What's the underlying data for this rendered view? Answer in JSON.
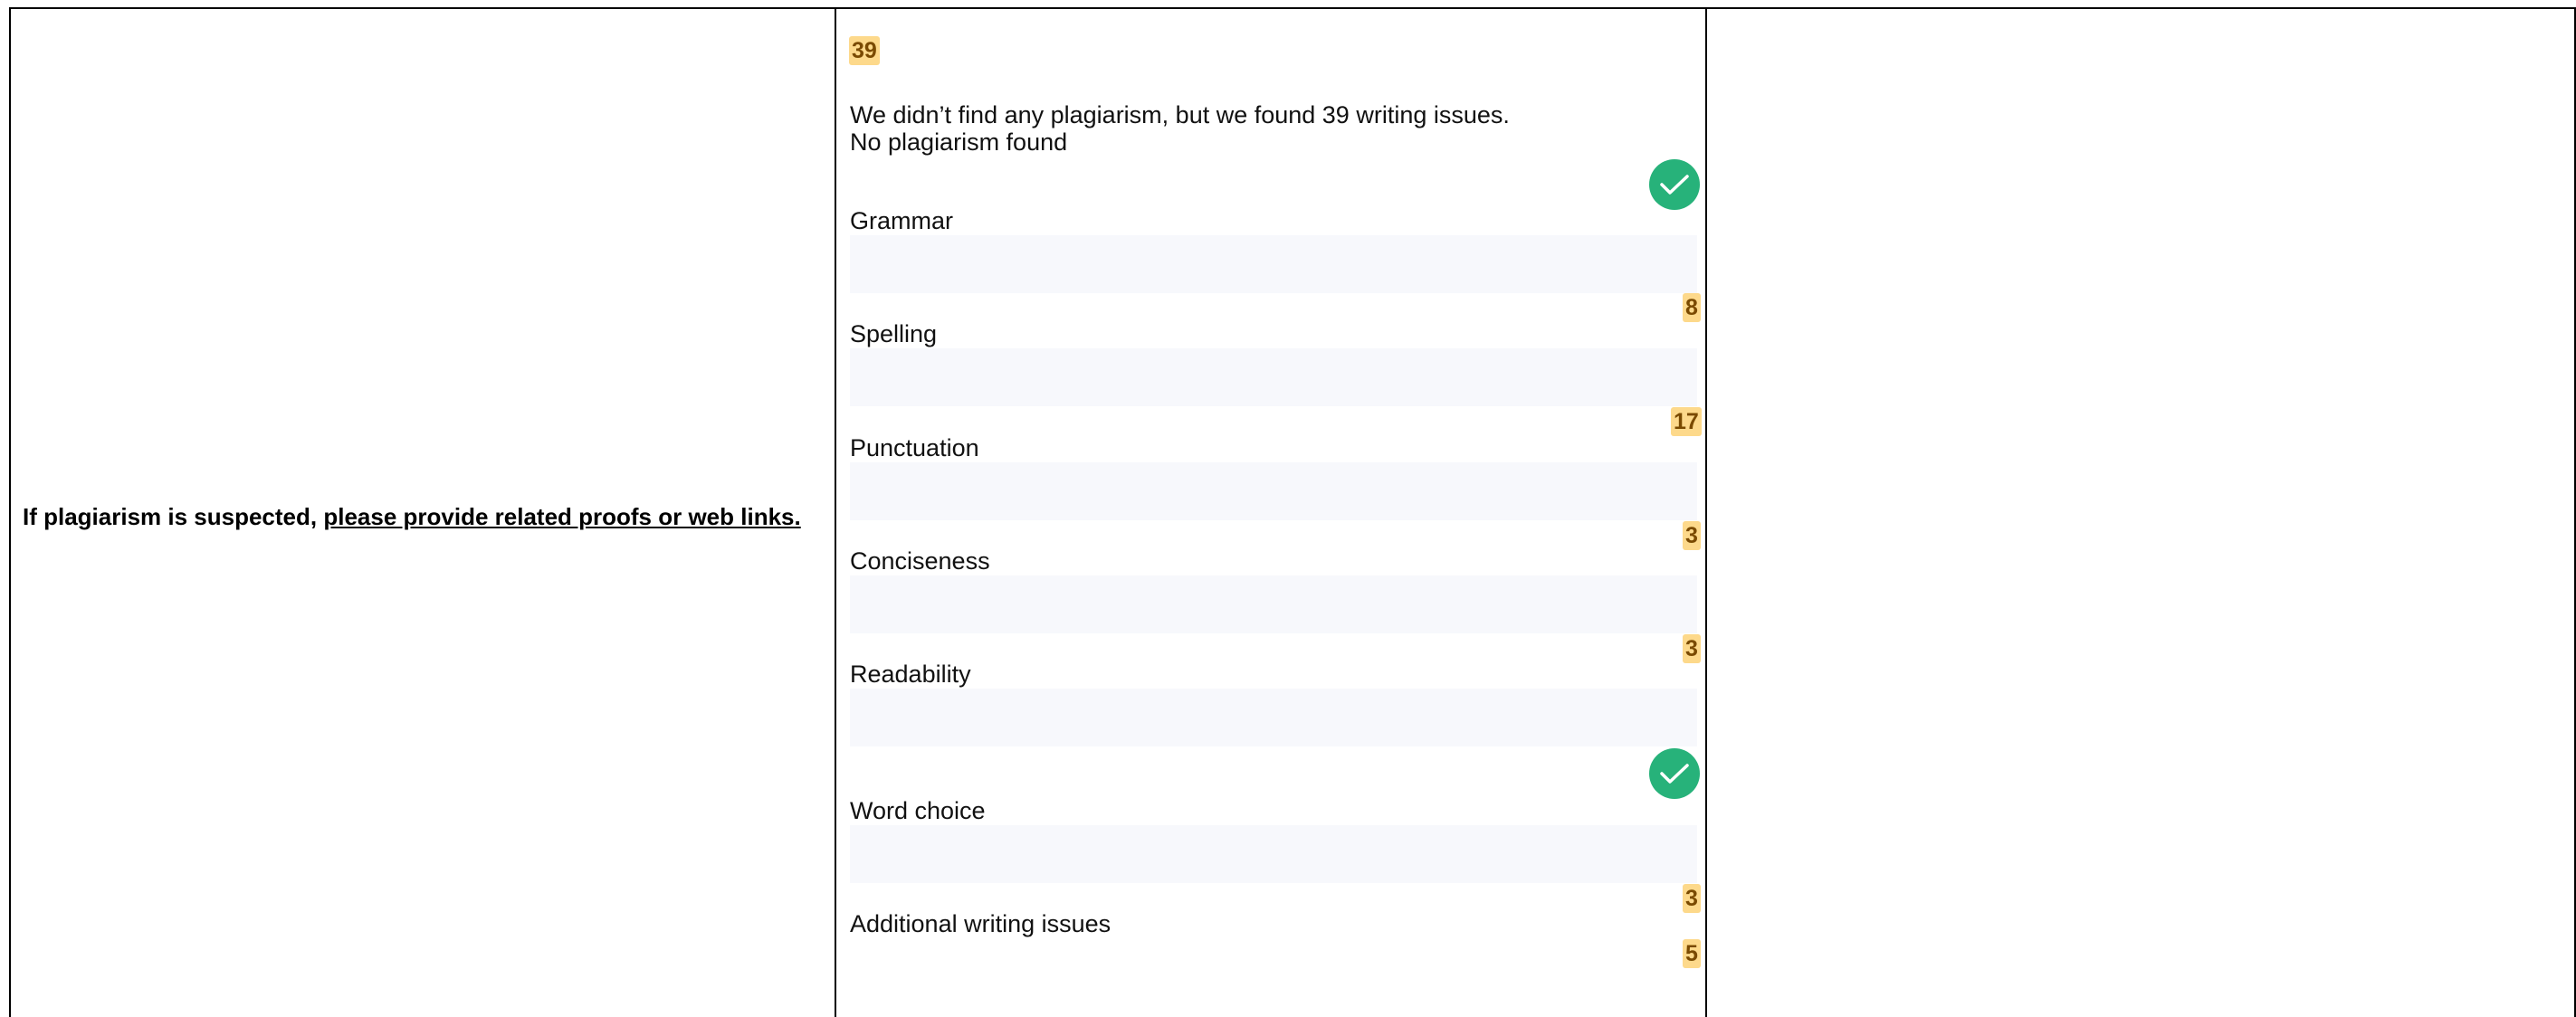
{
  "left": {
    "suspect_text": "If plagiarism is suspected, ",
    "suspect_link": "please provide related proofs or web links."
  },
  "report": {
    "total_issues": "39",
    "summary": "We didn’t find any plagiarism, but we found 39 writing issues.",
    "plagiarism_status": "No plagiarism found",
    "categories": [
      {
        "label": "Grammar",
        "count": "8"
      },
      {
        "label": "Spelling",
        "count": "17"
      },
      {
        "label": "Punctuation",
        "count": "3"
      },
      {
        "label": "Conciseness",
        "count": "3"
      },
      {
        "label": "Readability",
        "status": "check"
      },
      {
        "label": "Word choice",
        "count": "3"
      },
      {
        "label": "Additional writing issues",
        "count": "5"
      }
    ]
  },
  "colors": {
    "badge_bg": "#fdd98b",
    "badge_text": "#7a4a00",
    "check_green": "#27b27a",
    "bar_bg": "#f7f8fc"
  },
  "icons": {
    "ok": "check-circle-icon"
  }
}
